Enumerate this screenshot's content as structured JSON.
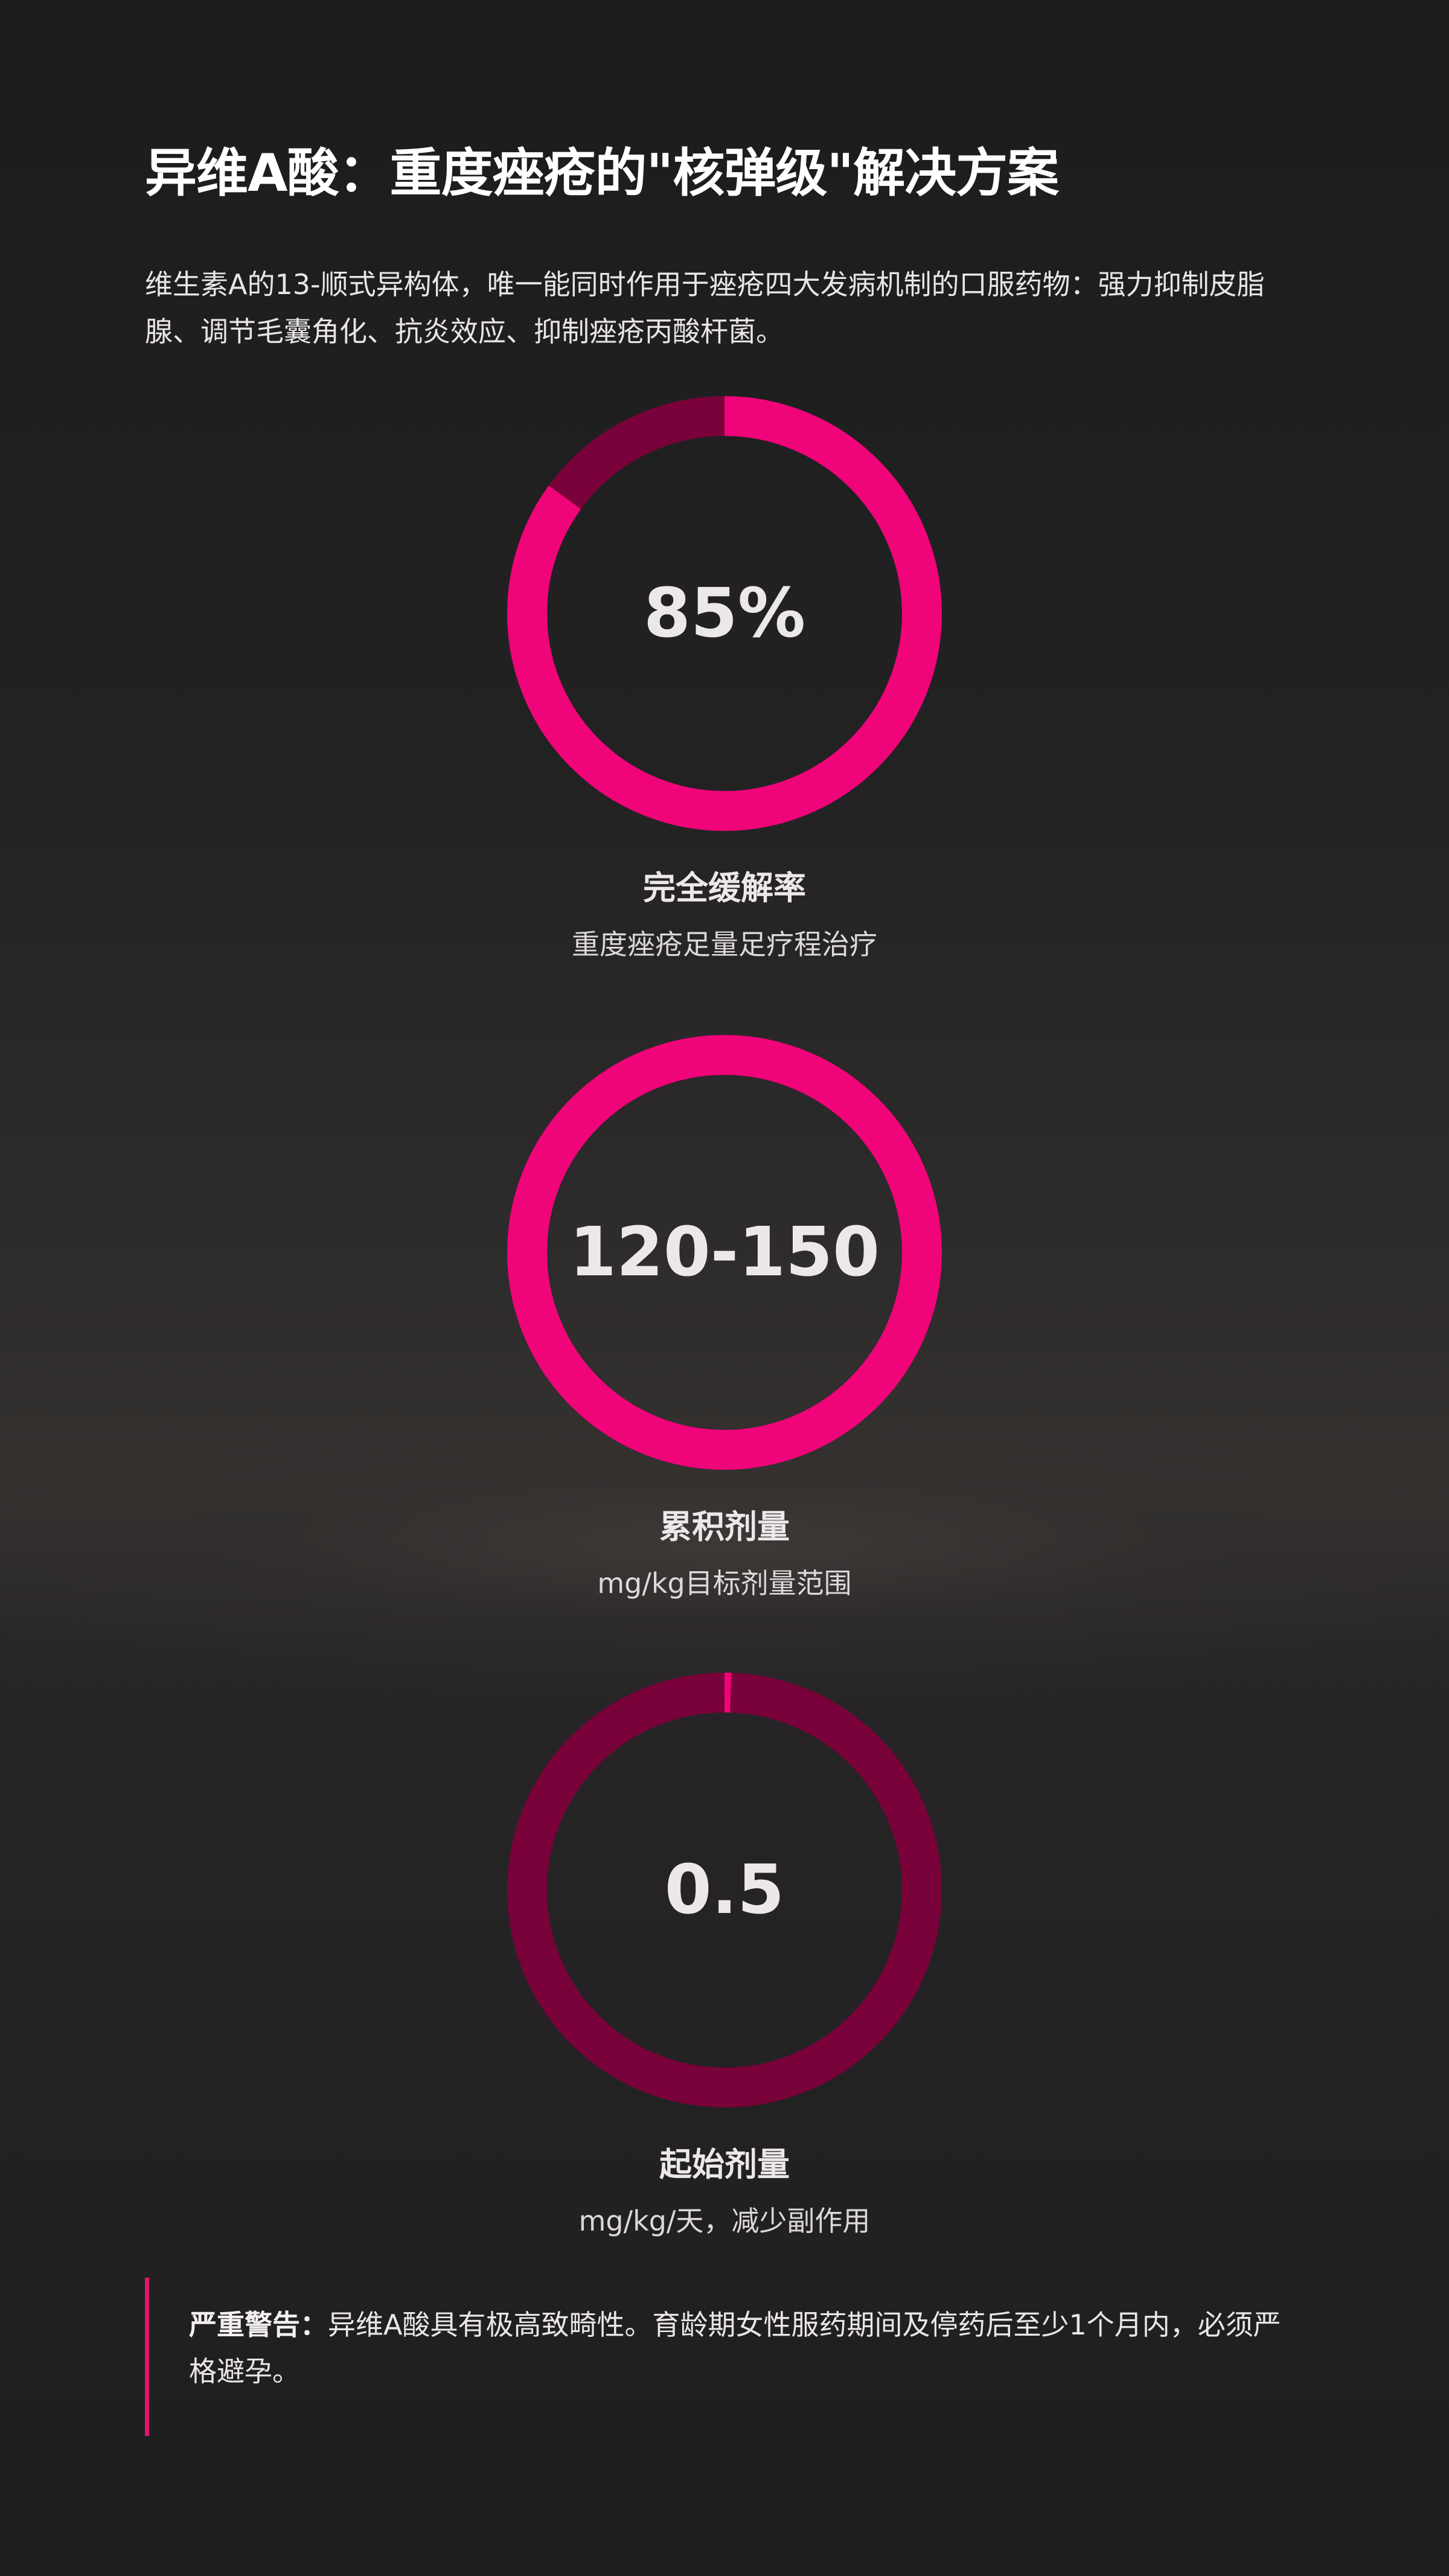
{
  "header": {
    "title": "异维A酸：重度痤疮的\"核弹级\"解决方案",
    "intro": "维生素A的13-顺式异构体，唯一能同时作用于痤疮四大发病机制的口服药物：强力抑制皮脂腺、调节毛囊角化、抗炎效应、抑制痤疮丙酸杆菌。"
  },
  "stats": [
    {
      "value": "85%",
      "label": "完全缓解率",
      "description": "重度痤疮足量足疗程治疗",
      "fill_fraction": 0.85
    },
    {
      "value": "120-150",
      "label": "累积剂量",
      "description": "mg/kg目标剂量范围",
      "fill_fraction": 1.0
    },
    {
      "value": "0.5",
      "label": "起始剂量",
      "description": "mg/kg/天，减少副作用",
      "fill_fraction": 0.005
    }
  ],
  "warning": {
    "label": "严重警告：",
    "text": "异维A酸具有极高致畸性。育龄期女性服药期间及停药后至少1个月内，必须严格避孕。"
  },
  "colors": {
    "accent": "#f0047a",
    "ring_track": "#780239",
    "background": "#222122",
    "warning_bar": "#e01670"
  }
}
